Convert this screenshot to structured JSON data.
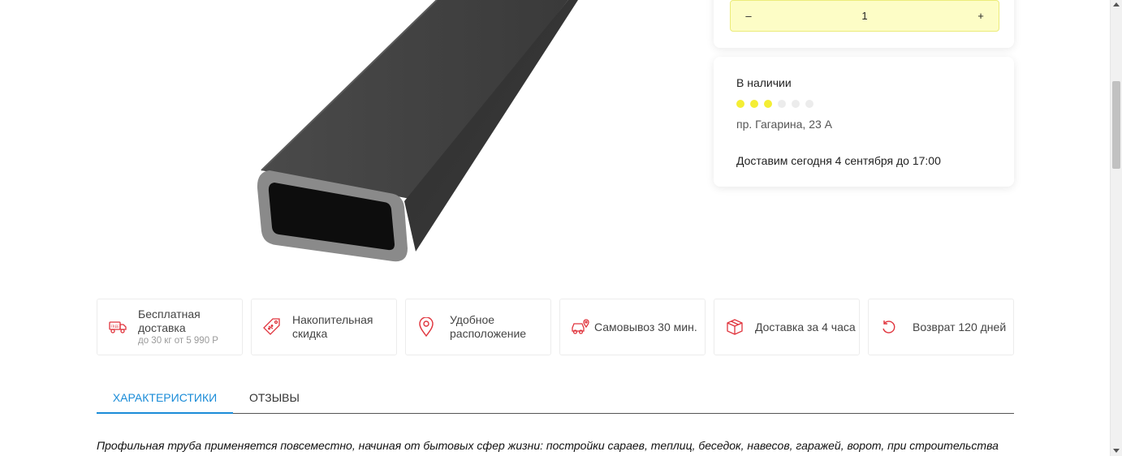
{
  "product": {
    "image_icon": "steel-profile-pipe"
  },
  "quantity": {
    "minus": "–",
    "value": "1",
    "plus": "+"
  },
  "stock": {
    "title": "В наличии",
    "level": 3,
    "level_max": 6,
    "address": "пр. Гагарина, 23 А",
    "delivery": "Доставим сегодня 4 сентября до 17:00",
    "dot_on_color": "#f4ee34",
    "dot_off_color": "#ececec"
  },
  "features": [
    {
      "icon": "truck-free-icon",
      "label": "Бесплатная доставка",
      "sub": "до 30 кг от 5 990 Р"
    },
    {
      "icon": "discount-tag-icon",
      "label": "Накопительная скидка"
    },
    {
      "icon": "location-pin-icon",
      "label": "Удобное расположение"
    },
    {
      "icon": "car-pickup-icon",
      "label": "Самовывоз 30 мин."
    },
    {
      "icon": "box-icon",
      "label": "Доставка за 4 часа"
    },
    {
      "icon": "return-arrow-icon",
      "label": "Возврат 120 дней"
    }
  ],
  "accent_color": "#e0343d",
  "tabs": [
    {
      "label": "Характеристики",
      "active": true
    },
    {
      "label": "Отзывы",
      "active": false
    }
  ],
  "tab_active_color": "#1a8cd8",
  "description": "Профильная труба применяется повсеместно, начиная от бытовых сфер жизни: постройки сараев, теплиц, беседок, навесов, гаражей, ворот, при строительства"
}
